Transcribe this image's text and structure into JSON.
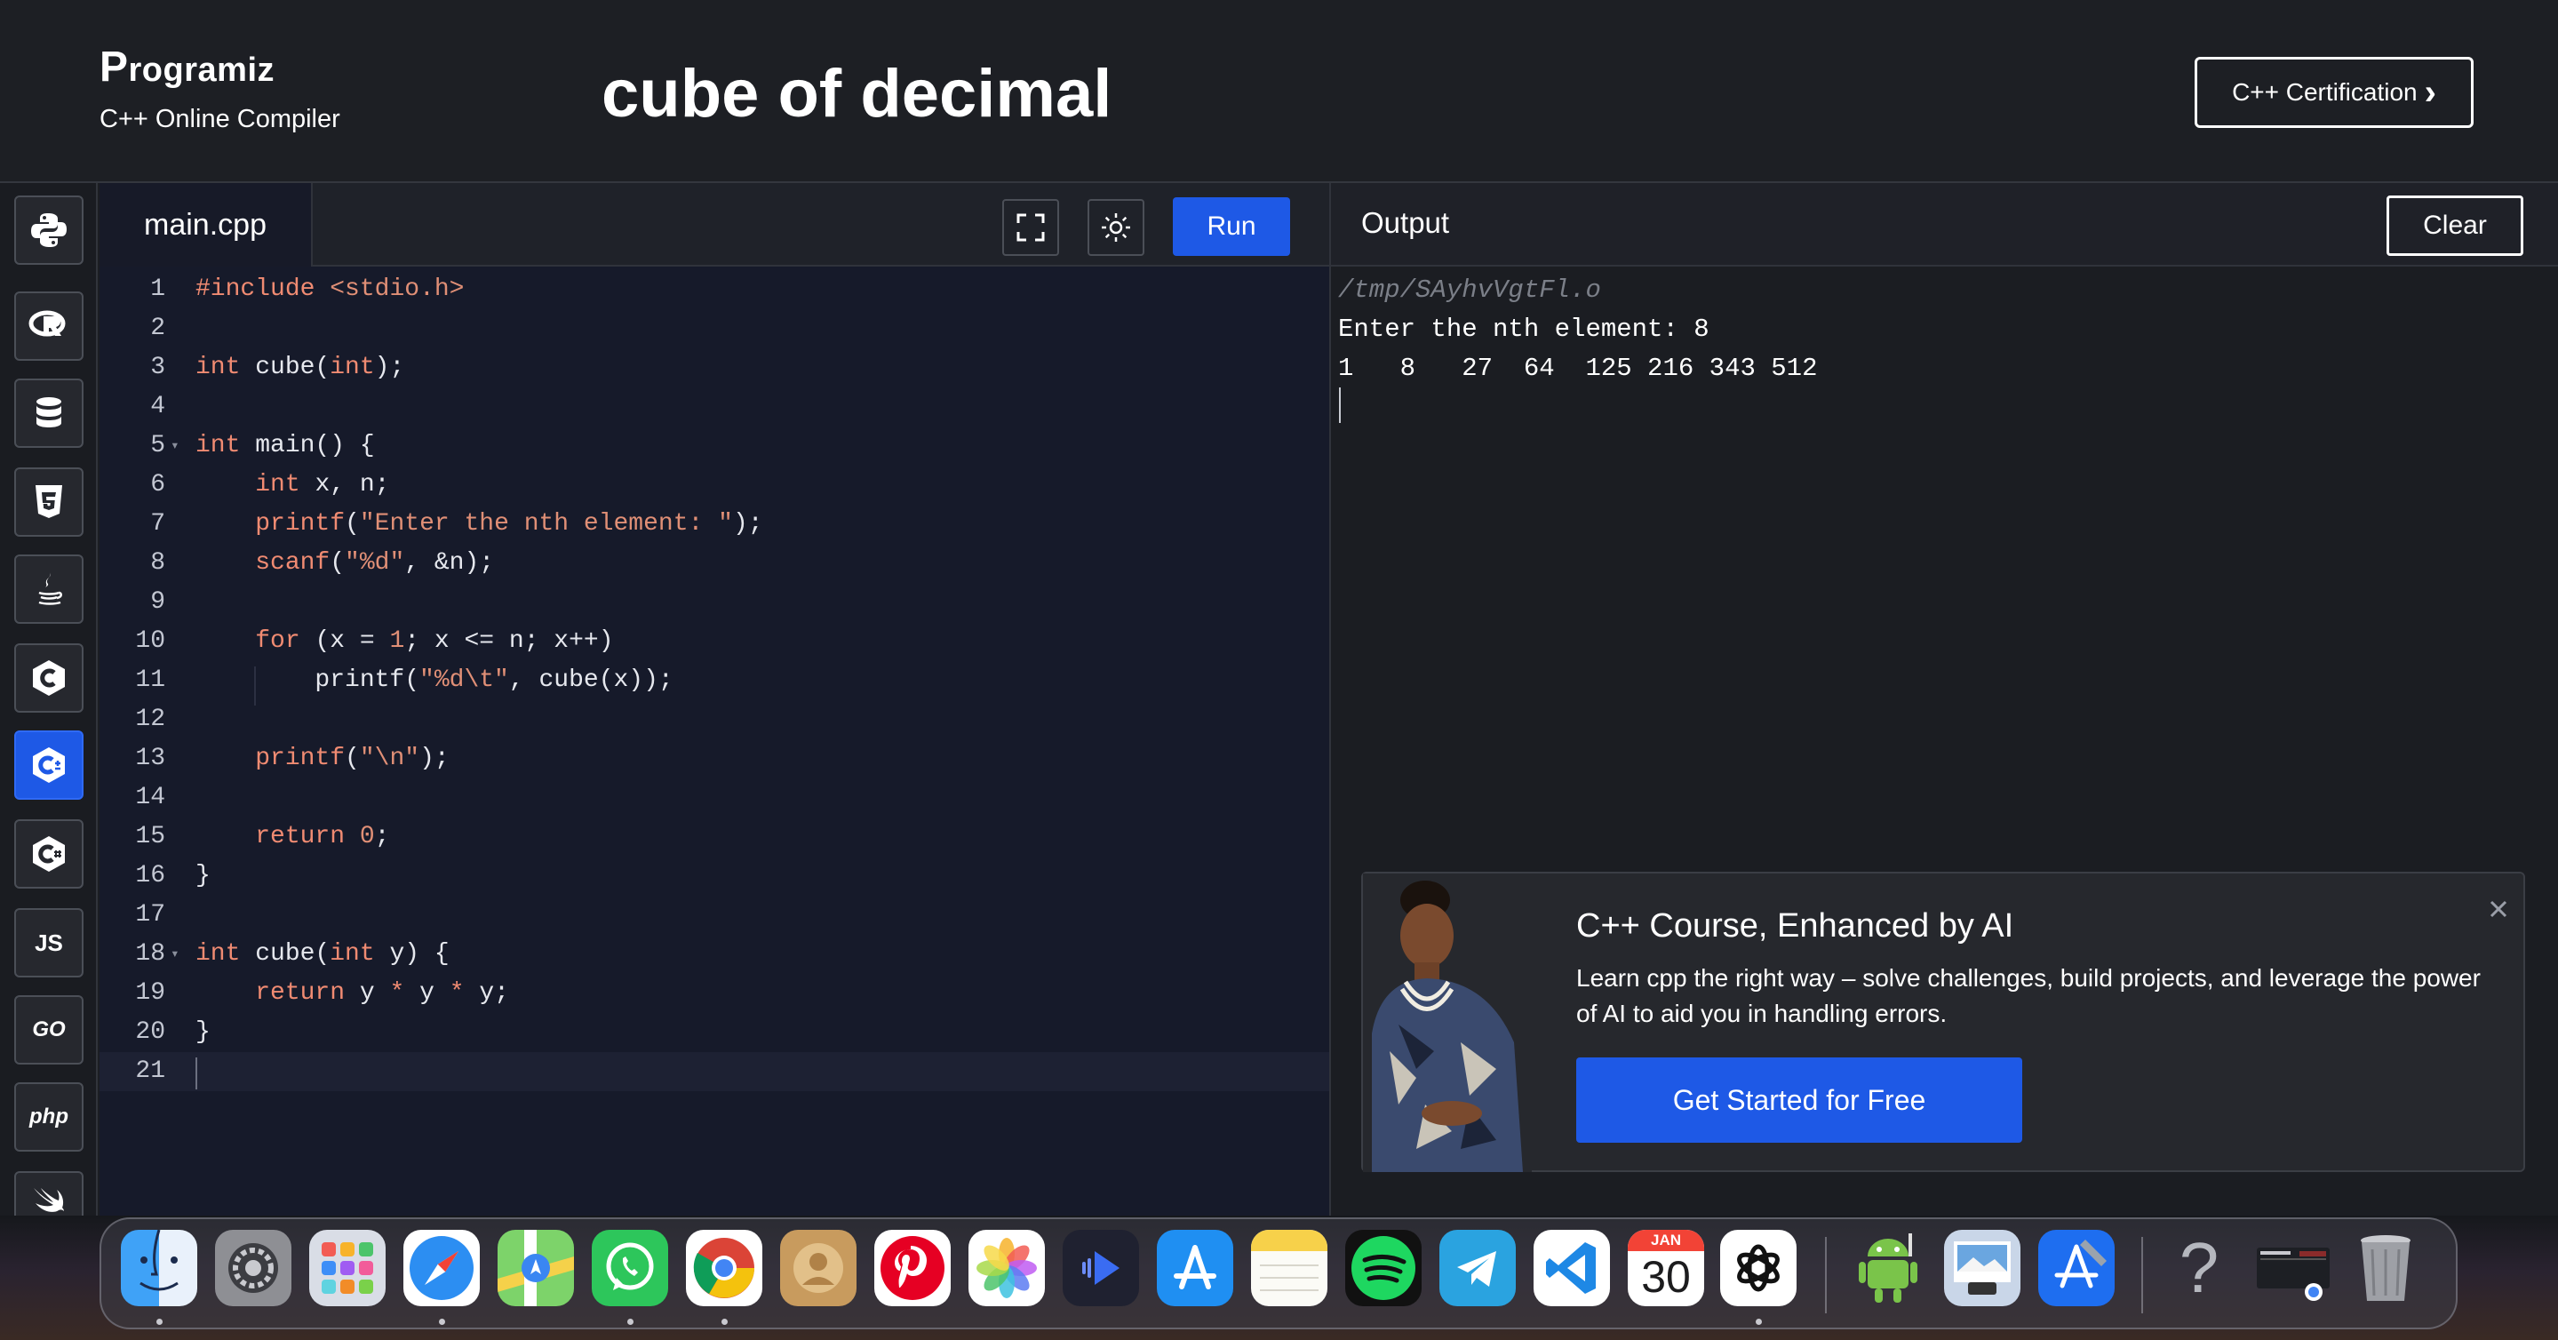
{
  "header": {
    "logo_text": "rogramiz",
    "logo_mark": "P",
    "subtitle": "C++ Online Compiler",
    "title": "cube of decimal",
    "cert_button": "C++ Certification",
    "cert_chevron": "›"
  },
  "sidebar": {
    "items": [
      {
        "name": "python-icon",
        "label": ""
      },
      {
        "name": "r-icon",
        "label": ""
      },
      {
        "name": "database-icon",
        "label": ""
      },
      {
        "name": "html5-icon",
        "label": ""
      },
      {
        "name": "java-icon",
        "label": ""
      },
      {
        "name": "c-icon",
        "label": ""
      },
      {
        "name": "cpp-icon",
        "label": "",
        "active": true
      },
      {
        "name": "csharp-icon",
        "label": ""
      },
      {
        "name": "js-icon",
        "label": "JS"
      },
      {
        "name": "go-icon",
        "label": "GO"
      },
      {
        "name": "php-icon",
        "label": "php"
      },
      {
        "name": "swift-icon",
        "label": ""
      }
    ]
  },
  "editor": {
    "file_tab": "main.cpp",
    "run_label": "Run",
    "lines": [
      {
        "n": "1",
        "code": " #include <stdio.h>"
      },
      {
        "n": "2",
        "code": ""
      },
      {
        "n": "3",
        "code": "int cube(int);"
      },
      {
        "n": "4",
        "code": ""
      },
      {
        "n": "5",
        "code": "int main() {"
      },
      {
        "n": "6",
        "code": "    int x, n;"
      },
      {
        "n": "7",
        "code": "    printf(\"Enter the nth element: \");"
      },
      {
        "n": "8",
        "code": "    scanf(\"%d\", &n);"
      },
      {
        "n": "9",
        "code": ""
      },
      {
        "n": "10",
        "code": "    for (x = 1; x <= n; x++)"
      },
      {
        "n": "11",
        "code": "        printf(\"%d\\t\", cube(x));"
      },
      {
        "n": "12",
        "code": ""
      },
      {
        "n": "13",
        "code": "    printf(\"\\n\");"
      },
      {
        "n": "14",
        "code": ""
      },
      {
        "n": "15",
        "code": "    return 0;"
      },
      {
        "n": "16",
        "code": "}"
      },
      {
        "n": "17",
        "code": ""
      },
      {
        "n": "18",
        "code": "int cube(int y) {"
      },
      {
        "n": "19",
        "code": "    return y * y * y;"
      },
      {
        "n": "20",
        "code": "}"
      },
      {
        "n": "21",
        "code": ""
      }
    ]
  },
  "output": {
    "title": "Output",
    "clear_label": "Clear",
    "path": "/tmp/SAyhvVgtFl.o",
    "prompt_line": "Enter the nth element: 8",
    "result_line": "1   8   27  64  125 216 343 512"
  },
  "ad": {
    "title": "C++ Course, Enhanced by AI",
    "description": "Learn cpp the right way – solve challenges, build projects, and leverage the power of AI to aid you in handling errors.",
    "cta": "Get Started for Free"
  },
  "dock": {
    "calendar_month": "JAN",
    "calendar_day": "30",
    "help_glyph": "?",
    "apps": [
      "finder-icon",
      "system-settings-icon",
      "launchpad-icon",
      "safari-icon",
      "maps-icon",
      "whatsapp-icon",
      "chrome-icon",
      "contacts-icon",
      "pinterest-icon",
      "photos-icon",
      "media-player-icon",
      "app-store-icon",
      "notes-icon",
      "spotify-icon",
      "telegram-icon",
      "vscode-icon",
      "calendar-icon",
      "chatgpt-icon",
      "android-studio-icon",
      "preview-icon",
      "xcode-icon",
      "help-icon",
      "window-thumbnail-icon",
      "trash-icon"
    ]
  },
  "colors": {
    "accent": "#1e59e6",
    "editor_bg": "#161a2a",
    "keyword": "#f08b72"
  }
}
